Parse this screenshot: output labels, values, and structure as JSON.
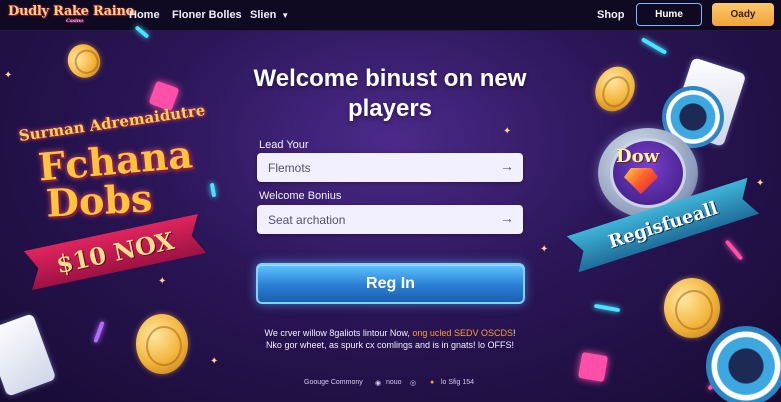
{
  "header": {
    "logo_text": "Dudly Rake Raino",
    "logo_sub": "Casino",
    "nav": {
      "home": "Home",
      "games": "Floner Bolles",
      "slots": "Slien",
      "shop": "Shop"
    },
    "btn_outline": "Hume",
    "btn_gold": "Oady"
  },
  "hero": {
    "headline": "Welcome binust on new players",
    "field1_label": "Lead Your",
    "field1_value": "Flemots",
    "field2_label": "Welcome  Bonius",
    "field2_value": "Seat archation",
    "register_button": "Reg In",
    "promo_line1_a": "We crver willow 8galiots lintour Now, ",
    "promo_line1_b": "ong ucled SEDV OSCDS",
    "promo_line1_c": "!",
    "promo_line2": "Nko gor wheet, as spurk cx comlings and is in gnats! lo OFFS!"
  },
  "footer": {
    "item1": "Goouge Commony",
    "item2": "nouo",
    "item3": "lo Sfig 154"
  },
  "art": {
    "left_line1": "Surman Adremaidutre",
    "left_line2": "Fchana",
    "left_line3": "Dobs",
    "left_ribbon": "$10 NOX",
    "right_badge": "Dow",
    "right_ribbon": "Regisfueall"
  },
  "icons": {
    "footer_icon1": "shield-icon",
    "footer_icon2": "coin-icon",
    "field_arrow": "arrow-right-icon",
    "caret": "chevron-down-icon"
  },
  "colors": {
    "accent_gold": "#f0a33a",
    "accent_blue": "#2a7fd4",
    "promo_highlight": "#ff9b3a"
  }
}
